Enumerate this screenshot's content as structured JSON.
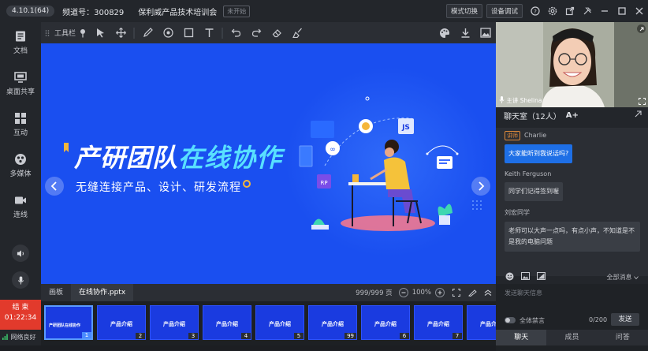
{
  "topbar": {
    "version": "4.10.1(64)",
    "channel": "频道号：300829",
    "title": "保利威产品技术培训会",
    "status": "未开始",
    "mode_switch": "模式切换",
    "device_test": "设备调试"
  },
  "sidebar": {
    "items": [
      {
        "label": "文档",
        "icon": "document-icon"
      },
      {
        "label": "桌面共享",
        "icon": "screen-share-icon"
      },
      {
        "label": "互动",
        "icon": "interaction-icon"
      },
      {
        "label": "多媒体",
        "icon": "multimedia-icon"
      },
      {
        "label": "连线",
        "icon": "camera-icon"
      }
    ],
    "end_label": "结 束",
    "timer": "01:22:34",
    "network": "网络良好"
  },
  "toolbar": {
    "label": "工具栏"
  },
  "slide": {
    "headline_a": "产研团队",
    "headline_b": "在线协作",
    "subtitle": "无缝连接产品、设计、研发流程",
    "badge_js": "JS"
  },
  "bottombar": {
    "tab_board": "画板",
    "tab_file": "在线协作.pptx",
    "pages": "999/999 页",
    "zoom": "100%"
  },
  "thumbnails": [
    {
      "label": "产研团队在线协作",
      "num": "1"
    },
    {
      "label": "产品介绍",
      "num": "2"
    },
    {
      "label": "产品介绍",
      "num": "3"
    },
    {
      "label": "产品介绍",
      "num": "4"
    },
    {
      "label": "产品介绍",
      "num": "5"
    },
    {
      "label": "产品介绍",
      "num": "99"
    },
    {
      "label": "产品介绍",
      "num": "6"
    },
    {
      "label": "产品介绍",
      "num": "7"
    },
    {
      "label": "产品介绍",
      "num": ""
    }
  ],
  "video": {
    "speaker": "主讲 Shelina"
  },
  "chat": {
    "title": "聊天室（12人）",
    "font_toggle": "A+",
    "role": "讲师",
    "messages": [
      {
        "name": "Charlie",
        "text": "大家能听到我说话吗?"
      },
      {
        "name": "Keith Ferguson",
        "text": "同学们记得签到喔"
      },
      {
        "name": "刘宏同学",
        "text": "老师可以大声一点吗，有点小声，不知道是不是我的电脑问题"
      }
    ],
    "filter": "全部消息",
    "placeholder": "发送聊天信息",
    "mute_all": "全体禁言",
    "count": "0/200",
    "send": "发送"
  },
  "rtabs": {
    "chat": "聊天",
    "members": "成员",
    "qa": "问答"
  },
  "colors": {
    "slide_bg": "#1a4ff0",
    "accent": "#58e0ff",
    "end_red": "#e23a2c",
    "bubble_blue": "#1e6fe6"
  }
}
